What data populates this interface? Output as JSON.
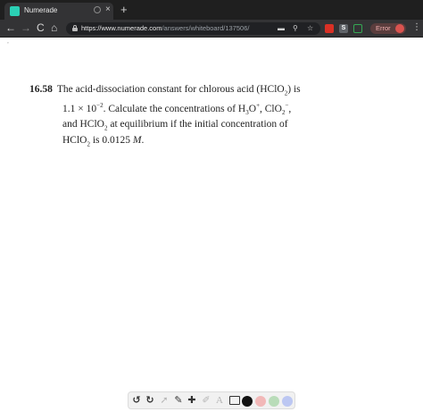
{
  "browser": {
    "tab": {
      "title": "Numerade",
      "close_glyph": "×"
    },
    "new_tab_glyph": "+",
    "nav": {
      "back": "←",
      "forward": "→",
      "reload": "C",
      "home": "⌂"
    },
    "url": {
      "host": "https://www.numerade.com",
      "path": "/answers/whiteboard/137506/"
    },
    "extensions": [
      {
        "name": "pdf-extension",
        "label": "",
        "color": "#d93025"
      },
      {
        "name": "s-extension",
        "label": "S",
        "color": "#5f6368"
      },
      {
        "name": "cast-extension",
        "label": "",
        "color": "#34a853"
      }
    ],
    "profile": {
      "status_text": "Error"
    },
    "menu_glyph": "⋮"
  },
  "page": {
    "marker": "˚",
    "problem": {
      "number": "16.58",
      "line1": "The acid-dissociation constant for chlorous acid (HClO",
      "line1_sub": "2",
      "line1_end": ") is",
      "line2_a": "1.1 × 10",
      "line2_sup": "−2",
      "line2_b": ". Calculate the concentrations of H",
      "line2_sub1": "3",
      "line2_c": "O",
      "line2_sup2": "+",
      "line2_d": ", ClO",
      "line2_sub2": "2",
      "line2_sup3": "−",
      "line2_e": ",",
      "line3_a": "and HClO",
      "line3_sub": "2",
      "line3_b": " at equilibrium if the initial concentration of",
      "line4_a": "HClO",
      "line4_sub": "2",
      "line4_b": " is 0.0125 ",
      "line4_unit": "M",
      "line4_end": "."
    }
  },
  "whiteboard_toolbar": {
    "undo": "↺",
    "redo": "↻",
    "select": "➚",
    "pen": "✎",
    "add": "✚",
    "eraser": "✐",
    "text": "A",
    "colors": [
      "#111111",
      "#f2b8b8",
      "#b9dcb9",
      "#bcc7f2"
    ]
  }
}
